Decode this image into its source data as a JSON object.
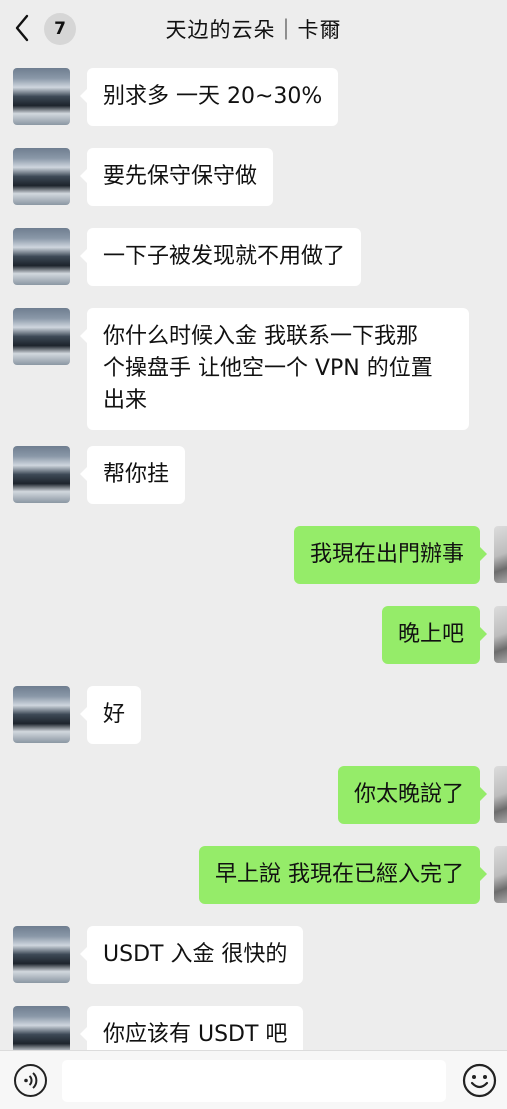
{
  "header": {
    "back_icon": "chevron-left-icon",
    "unread_count": "7",
    "title": "天边的云朵｜卡爾"
  },
  "messages": [
    {
      "side": "left",
      "text": "别求多 一天 20~30%"
    },
    {
      "side": "left",
      "text": "要先保守保守做"
    },
    {
      "side": "left",
      "text": "一下子被发现就不用做了"
    },
    {
      "side": "left",
      "lines": [
        "你什么时候入金 我联系一下我那",
        "个操盘手 让他空一个 VPN 的位置",
        "出来"
      ]
    },
    {
      "side": "left",
      "text": "帮你挂"
    },
    {
      "side": "right",
      "text": "我現在出門辦事"
    },
    {
      "side": "right",
      "text": "晚上吧"
    },
    {
      "side": "left",
      "text": "好"
    },
    {
      "side": "right",
      "text": "你太晚說了"
    },
    {
      "side": "right",
      "text": "早上說 我現在已經入完了"
    },
    {
      "side": "left",
      "text": "USDT 入金 很快的"
    },
    {
      "side": "left",
      "text": "你应该有 USDT 吧"
    }
  ],
  "input_bar": {
    "voice_icon": "voice-icon",
    "input_value": "",
    "emoji_icon": "emoji-icon"
  },
  "colors": {
    "background": "#ededed",
    "self_bubble": "#95ec69",
    "other_bubble": "#ffffff"
  }
}
